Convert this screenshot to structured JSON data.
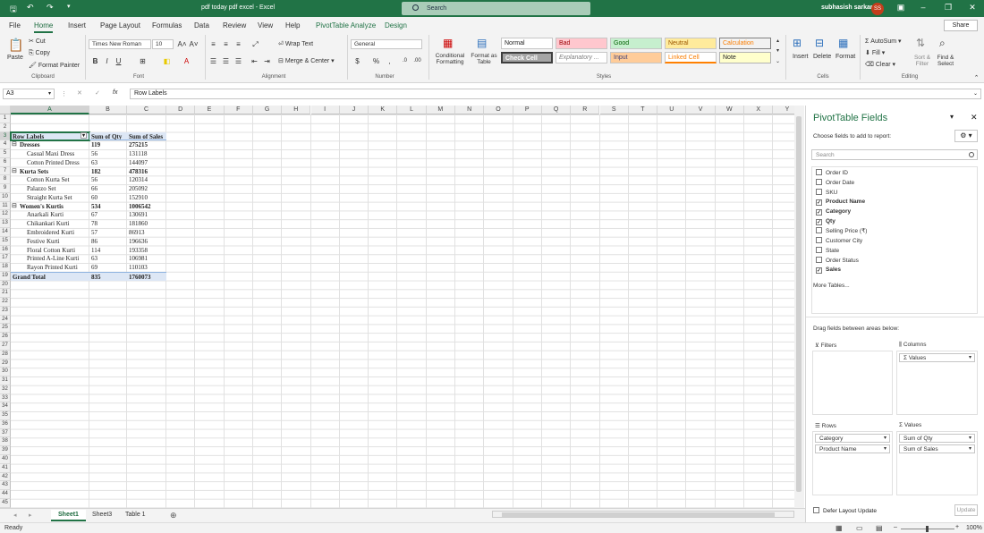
{
  "titlebar": {
    "document_title": "pdf today pdf excel  -  Excel",
    "search_placeholder": "Search",
    "user_name": "subhasish sarkar",
    "user_initials": "SS"
  },
  "menu": {
    "tabs": [
      "File",
      "Home",
      "Insert",
      "Page Layout",
      "Formulas",
      "Data",
      "Review",
      "View",
      "Help",
      "PivotTable Analyze",
      "Design"
    ],
    "active_tab": "Home",
    "share_label": "Share"
  },
  "ribbon": {
    "clipboard": {
      "paste": "Paste",
      "cut": "Cut",
      "copy": "Copy",
      "format_painter": "Format Painter",
      "group": "Clipboard"
    },
    "font": {
      "family": "Times New Roman",
      "size": "10",
      "group": "Font"
    },
    "alignment": {
      "wrap_text": "Wrap Text",
      "merge_center": "Merge & Center",
      "group": "Alignment"
    },
    "number": {
      "format": "General",
      "group": "Number"
    },
    "styles": {
      "conditional_formatting": "Conditional Formatting",
      "format_as_table": "Format as Table",
      "normal": "Normal",
      "bad": "Bad",
      "good": "Good",
      "neutral": "Neutral",
      "calculation": "Calculation",
      "check_cell": "Check Cell",
      "explanatory": "Explanatory ...",
      "input": "Input",
      "linked_cell": "Linked Cell",
      "note": "Note",
      "group": "Styles"
    },
    "cells": {
      "insert": "Insert",
      "delete": "Delete",
      "format": "Format",
      "group": "Cells"
    },
    "editing": {
      "autosum": "AutoSum",
      "fill": "Fill",
      "clear": "Clear",
      "sort_filter": "Sort & Filter",
      "find_select": "Find & Select",
      "group": "Editing"
    }
  },
  "formula_bar": {
    "name_box": "A3",
    "fx": "fx",
    "content": "Row Labels"
  },
  "grid": {
    "columns": [
      "A",
      "B",
      "C",
      "D",
      "E",
      "F",
      "G",
      "H",
      "I",
      "J",
      "K",
      "L",
      "M",
      "N",
      "O",
      "P",
      "Q",
      "R",
      "S",
      "T",
      "U",
      "V",
      "W",
      "X",
      "Y"
    ],
    "row_numbers": [
      "1",
      "2",
      "3",
      "4",
      "5",
      "6",
      "7",
      "8",
      "9",
      "10",
      "11",
      "12",
      "13",
      "14",
      "15",
      "16",
      "17",
      "18",
      "19",
      "20",
      "21",
      "22",
      "23",
      "24",
      "25",
      "26",
      "27",
      "28",
      "29",
      "30",
      "31",
      "32",
      "33",
      "34",
      "35",
      "36",
      "37",
      "38",
      "39",
      "40",
      "41",
      "42",
      "43",
      "44",
      "45"
    ],
    "pivot_header": [
      "Row Labels",
      "Sum of  Qty",
      "Sum of Sales"
    ],
    "pivot_rows": [
      {
        "label": "Dresses",
        "qty": "119",
        "sales": "275215",
        "level": 0
      },
      {
        "label": "Casual Maxi Dress",
        "qty": "56",
        "sales": "131118",
        "level": 1
      },
      {
        "label": "Cotton Printed Dress",
        "qty": "63",
        "sales": "144097",
        "level": 1
      },
      {
        "label": "Kurta Sets",
        "qty": "182",
        "sales": "478316",
        "level": 0
      },
      {
        "label": "Cotton Kurta Set",
        "qty": "56",
        "sales": "120314",
        "level": 1
      },
      {
        "label": "Palazzo Set",
        "qty": "66",
        "sales": "205092",
        "level": 1
      },
      {
        "label": "Straight Kurta Set",
        "qty": "60",
        "sales": "152910",
        "level": 1
      },
      {
        "label": "Women's Kurtis",
        "qty": "534",
        "sales": "1006542",
        "level": 0
      },
      {
        "label": "Anarkali Kurti",
        "qty": "67",
        "sales": "130691",
        "level": 1
      },
      {
        "label": "Chikankari Kurti",
        "qty": "78",
        "sales": "181860",
        "level": 1
      },
      {
        "label": "Embroidered Kurti",
        "qty": "57",
        "sales": "86913",
        "level": 1
      },
      {
        "label": "Festive Kurti",
        "qty": "86",
        "sales": "196636",
        "level": 1
      },
      {
        "label": "Floral Cotton Kurti",
        "qty": "114",
        "sales": "193358",
        "level": 1
      },
      {
        "label": "Printed A-Line Kurti",
        "qty": "63",
        "sales": "106981",
        "level": 1
      },
      {
        "label": "Rayon Printed Kurti",
        "qty": "69",
        "sales": "110103",
        "level": 1
      }
    ],
    "grand_total": {
      "label": "Grand Total",
      "qty": "835",
      "sales": "1760073"
    }
  },
  "sheets": {
    "tabs": [
      "Sheet1",
      "Sheet3",
      "Table 1"
    ],
    "active": "Sheet1"
  },
  "status": {
    "left": "Ready",
    "zoom": "100%"
  },
  "pivot_pane": {
    "title": "PivotTable Fields",
    "subtitle": "Choose fields to add to report:",
    "search_placeholder": "Search",
    "fields": [
      {
        "name": "Order ID",
        "checked": false
      },
      {
        "name": "Order Date",
        "checked": false
      },
      {
        "name": "SKU",
        "checked": false
      },
      {
        "name": "Product Name",
        "checked": true
      },
      {
        "name": "Category",
        "checked": true
      },
      {
        "name": "Qty",
        "checked": true
      },
      {
        "name": "Selling Price (₹)",
        "checked": false
      },
      {
        "name": "Customer City",
        "checked": false
      },
      {
        "name": "State",
        "checked": false
      },
      {
        "name": "Order Status",
        "checked": false
      },
      {
        "name": "Sales",
        "checked": true
      }
    ],
    "more_tables": "More Tables...",
    "drag_label": "Drag fields between areas below:",
    "filters_label": "Filters",
    "columns_label": "Columns",
    "columns_items": [
      "Σ  Values"
    ],
    "rows_label": "Rows",
    "rows_items": [
      "Category",
      "Product Name"
    ],
    "values_label": "Values",
    "values_items": [
      "Sum of  Qty",
      "Sum of Sales"
    ],
    "defer_label": "Defer Layout Update",
    "update_label": "Update"
  }
}
